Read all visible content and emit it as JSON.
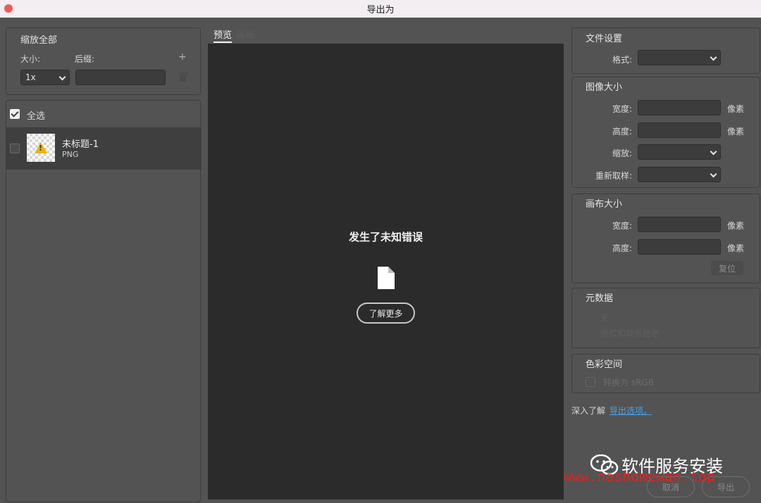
{
  "window": {
    "title": "导出为"
  },
  "scale_panel": {
    "title": "缩放全部",
    "size_label": "大小:",
    "suffix_label": "后缀:",
    "size_value": "1x",
    "suffix_value": "",
    "add_icon": "plus-icon",
    "delete_icon": "trash-icon"
  },
  "assets": {
    "select_all_label": "全选",
    "select_all_checked": true,
    "items": [
      {
        "name": "未标题-1",
        "format": "PNG",
        "checked": false,
        "thumb_icon": "warning-icon"
      }
    ]
  },
  "preview": {
    "tabs": [
      {
        "label": "预览",
        "active": true
      },
      {
        "label": "画板",
        "active": false
      }
    ],
    "error_title": "发生了未知错误",
    "error_icon": "document-icon",
    "learn_more_label": "了解更多"
  },
  "file_settings": {
    "title": "文件设置",
    "format_label": "格式:",
    "format_value": ""
  },
  "image_size": {
    "title": "图像大小",
    "width_label": "宽度:",
    "height_label": "高度:",
    "scale_label": "缩放:",
    "resample_label": "重新取样:",
    "unit": "像素",
    "width_value": "",
    "height_value": "",
    "scale_value": "",
    "resample_value": ""
  },
  "canvas_size": {
    "title": "画布大小",
    "width_label": "宽度:",
    "height_label": "高度:",
    "unit": "像素",
    "reset_label": "复位",
    "width_value": "",
    "height_value": ""
  },
  "metadata": {
    "title": "元数据",
    "option_none": "无",
    "option_copyright": "版权和联系信息"
  },
  "color_space": {
    "title": "色彩空间",
    "convert_label": "转换为 sRGB",
    "convert_checked": false
  },
  "learn": {
    "prefix": "深入了解",
    "link_label": "导出选项。"
  },
  "buttons": {
    "cancel_label": "取消",
    "export_label": "导出"
  },
  "watermark": {
    "text": "软件服务安装",
    "url": "www.nashomewan.top"
  },
  "colors": {
    "window_bg": "#535353",
    "preview_bg": "#2b2b2b",
    "link": "#4aa3e8",
    "warning": "#e8b416",
    "watermark_url": "#e8201e"
  }
}
